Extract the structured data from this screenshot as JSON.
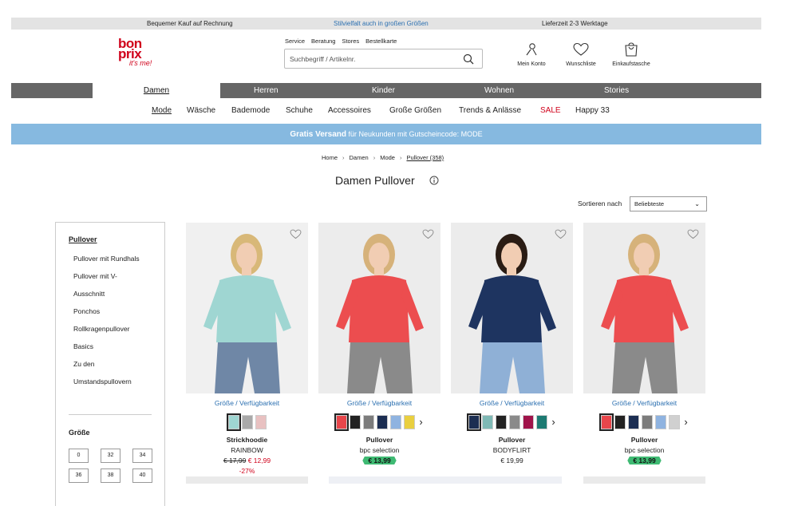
{
  "topbar": {
    "left": "Bequemer Kauf auf Rechnung",
    "center": "Stilvielfalt auch in großen Größen",
    "right": "Lieferzeit 2-3 Werktage"
  },
  "logo": {
    "line1": "bon",
    "line2": "prix",
    "tagline": "it's me!"
  },
  "service_links": [
    "Service",
    "Beratung",
    "Stores",
    "Bestellkarte"
  ],
  "search": {
    "placeholder": "Suchbegriff / Artikelnr.",
    "icon": "search-icon"
  },
  "account": [
    {
      "label": "Mein Konto",
      "icon": "person-icon"
    },
    {
      "label": "Wunschliste",
      "icon": "heart-icon"
    },
    {
      "label": "Einkaufstasche",
      "icon": "bag-icon"
    }
  ],
  "main_nav": {
    "active": "Damen",
    "items": [
      "Herren",
      "Kinder",
      "Wohnen",
      "Stories"
    ]
  },
  "sub_nav": [
    "Mode",
    "Wäsche",
    "Bademode",
    "Schuhe",
    "Accessoires",
    "Große Größen",
    "Trends & Anlässe",
    "SALE",
    "Happy 33"
  ],
  "promo": {
    "bold": "Gratis Versand",
    "rest": " für Neukunden mit Gutscheincode: MODE"
  },
  "breadcrumb": [
    "Home",
    "Damen",
    "Mode",
    "Pullover (358)"
  ],
  "page_title": "Damen Pullover",
  "sort": {
    "label": "Sortieren nach",
    "selected": "Beliebteste"
  },
  "sidebar": {
    "heading": "Pullover",
    "items": [
      "Pullover mit Rundhals",
      "Pullover mit V-",
      "Ausschnitt",
      "Ponchos",
      "Rollkragenpullover",
      "Basics",
      "Zu den",
      "Umstandspullovern"
    ],
    "size_heading": "Größe",
    "sizes": [
      "0",
      "32",
      "34",
      "36",
      "38",
      "40"
    ]
  },
  "products": [
    {
      "availability": "Größe / Verfügbarkeit",
      "name": "Strickhoodie",
      "brand": "RAINBOW",
      "old_price": "€ 17,99",
      "price": "€ 12,99",
      "discount": "-27%",
      "swatches": [
        "#9fd6d2",
        "#a9a9a9",
        "#e8c1c1"
      ],
      "more": false,
      "tag": false,
      "image": {
        "bg": "#f0f0f0",
        "top": "#9fd6d2",
        "bottom": "#6f87a6",
        "hair": "#d8b878"
      }
    },
    {
      "availability": "Größe / Verfügbarkeit",
      "name": "Pullover",
      "brand": "bpc selection",
      "price": "€ 13,99",
      "tag": true,
      "swatches": [
        "#e8464b",
        "#222222",
        "#7c7c7c",
        "#1c2e52",
        "#8fb3e0",
        "#e9cf3f"
      ],
      "more": true,
      "image": {
        "bg": "#ececec",
        "top": "#ec4d4f",
        "bottom": "#8a8a8a",
        "hair": "#d6b27a"
      }
    },
    {
      "availability": "Größe / Verfügbarkeit",
      "name": "Pullover",
      "brand": "BODYFLIRT",
      "price": "€ 19,99",
      "tag": false,
      "swatches": [
        "#1c2e52",
        "#7fb9b5",
        "#222222",
        "#8a8a8a",
        "#a0134a",
        "#1d7a72"
      ],
      "more": true,
      "image": {
        "bg": "#ececec",
        "top": "#1e3460",
        "bottom": "#8fb0d6",
        "hair": "#2a1c14"
      }
    },
    {
      "availability": "Größe / Verfügbarkeit",
      "name": "Pullover",
      "brand": "bpc selection",
      "price": "€ 13,99",
      "tag": true,
      "swatches": [
        "#e8464b",
        "#222222",
        "#1c2e52",
        "#7c7c7c",
        "#8fb3e0",
        "#d0d0d0"
      ],
      "more": true,
      "image": {
        "bg": "#ececec",
        "top": "#ec4d4f",
        "bottom": "#8a8a8a",
        "hair": "#d6b27a"
      }
    }
  ]
}
